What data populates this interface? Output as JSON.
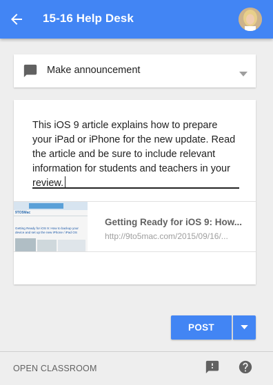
{
  "appbar": {
    "title": "15-16 Help Desk",
    "back_icon": "arrow-back-icon",
    "avatar": "user-avatar"
  },
  "post_type": {
    "icon": "announcement-icon",
    "label": "Make announcement",
    "dropdown_icon": "arrow-drop-down-icon"
  },
  "post": {
    "text": "This iOS 9 article explains how to prepare your iPad or iPhone for the new update. Read the article and be sure to include relevant information for students and teachers in your review."
  },
  "attachment": {
    "title": "Getting Ready for iOS 9: How...",
    "url": "http://9to5mac.com/2015/09/16/...",
    "thumbnail": {
      "logo": "9TO5Mac",
      "caption": "Getting Ready for iOS 9: How to backup your device and set up the new iPhone / iPad OS"
    }
  },
  "actions": {
    "post_label": "POST",
    "post_menu_icon": "arrow-drop-down-icon"
  },
  "footer": {
    "open_classroom_label": "OPEN CLASSROOM",
    "feedback_icon": "feedback-icon",
    "help_icon": "help-icon"
  },
  "colors": {
    "primary": "#4285f4",
    "background": "#eeeeee"
  }
}
